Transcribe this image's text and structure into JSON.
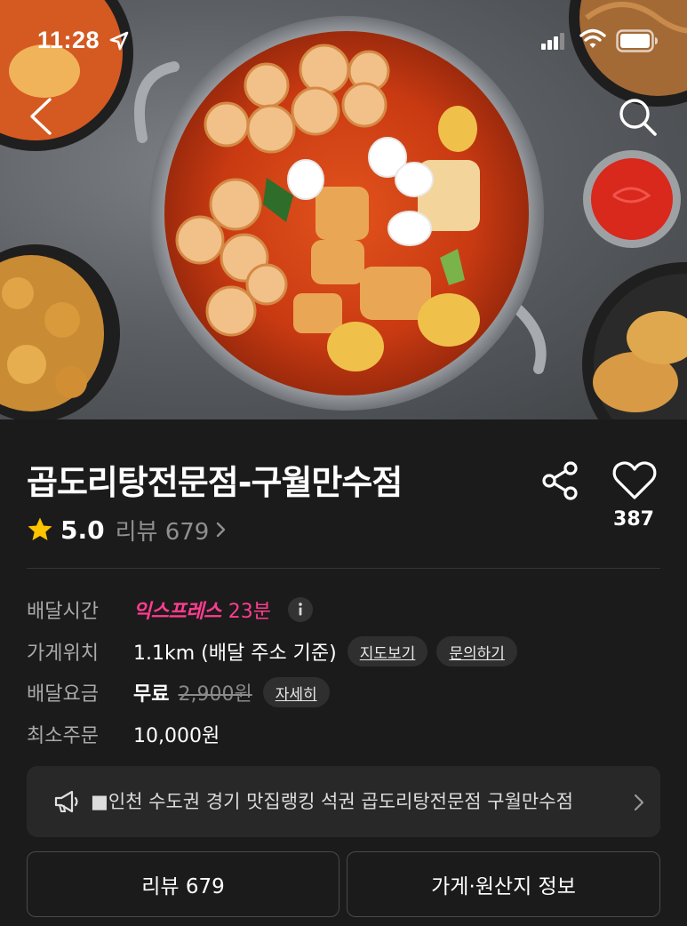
{
  "status_bar": {
    "time": "11:28"
  },
  "store": {
    "name": "곱도리탕전문점-구월만수점",
    "rating": "5.0",
    "review_text": "리뷰 679",
    "like_count": "387"
  },
  "details": {
    "delivery_time": {
      "label": "배달시간",
      "express": "익스프레스",
      "minutes": "23분"
    },
    "location": {
      "label": "가게위치",
      "value": "1.1km (배달 주소 기준)",
      "map_chip": "지도보기",
      "inquiry_chip": "문의하기"
    },
    "delivery_fee": {
      "label": "배달요금",
      "free": "무료",
      "original": "2,900원",
      "detail_chip": "자세히"
    },
    "min_order": {
      "label": "최소주문",
      "value": "10,000원"
    }
  },
  "notice": {
    "text": "■인천 수도권 경기 맛집랭킹 석권 곱도리탕전문점 구월만수점"
  },
  "tabs": {
    "review": "리뷰 679",
    "store_info": "가게·원산지 정보"
  },
  "colors": {
    "background": "#1b1b1b",
    "accent_pink": "#ff3d8f",
    "star": "#ffc400"
  },
  "icons": [
    "back-arrow-icon",
    "search-icon",
    "share-icon",
    "heart-icon",
    "star-icon",
    "chevron-right-icon",
    "info-icon",
    "megaphone-icon",
    "location-arrow-icon",
    "signal-icon",
    "wifi-icon",
    "battery-icon"
  ]
}
